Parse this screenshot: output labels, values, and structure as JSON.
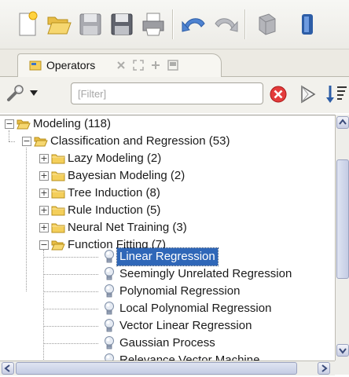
{
  "toolbar": {
    "buttons": [
      {
        "name": "new-process-button",
        "icon": "new-document-icon"
      },
      {
        "name": "open-process-button",
        "icon": "open-folder-icon"
      },
      {
        "name": "save-button",
        "icon": "save-icon"
      },
      {
        "name": "save-as-button",
        "icon": "save-as-icon"
      },
      {
        "name": "print-button",
        "icon": "print-icon"
      },
      {
        "name": "undo-button",
        "icon": "undo-icon"
      },
      {
        "name": "redo-button",
        "icon": "redo-icon"
      },
      {
        "name": "run-button",
        "icon": "run-icon"
      }
    ]
  },
  "panel": {
    "tab_label": "Operators",
    "filter_placeholder": "[Filter]"
  },
  "tree": {
    "root": {
      "label": "Modeling (118)",
      "expanded": true
    },
    "group": {
      "label": "Classification and Regression (53)",
      "expanded": true
    },
    "folders": [
      {
        "label": "Lazy Modeling (2)",
        "expanded": false
      },
      {
        "label": "Bayesian Modeling (2)",
        "expanded": false
      },
      {
        "label": "Tree Induction (8)",
        "expanded": false
      },
      {
        "label": "Rule Induction (5)",
        "expanded": false
      },
      {
        "label": "Neural Net Training (3)",
        "expanded": false
      },
      {
        "label": "Function Fitting (7)",
        "expanded": true
      }
    ],
    "operators": [
      {
        "label": "Linear Regression",
        "selected": true
      },
      {
        "label": "Seemingly Unrelated Regression",
        "selected": false
      },
      {
        "label": "Polynomial Regression",
        "selected": false
      },
      {
        "label": "Local Polynomial Regression",
        "selected": false
      },
      {
        "label": "Vector Linear Regression",
        "selected": false
      },
      {
        "label": "Gaussian Process",
        "selected": false
      },
      {
        "label": "Relevance Vector Machine",
        "selected": false
      }
    ]
  },
  "colors": {
    "selection": "#2f67b8",
    "folder": "#f2c94c",
    "scrollbar": "#c4cce4"
  }
}
